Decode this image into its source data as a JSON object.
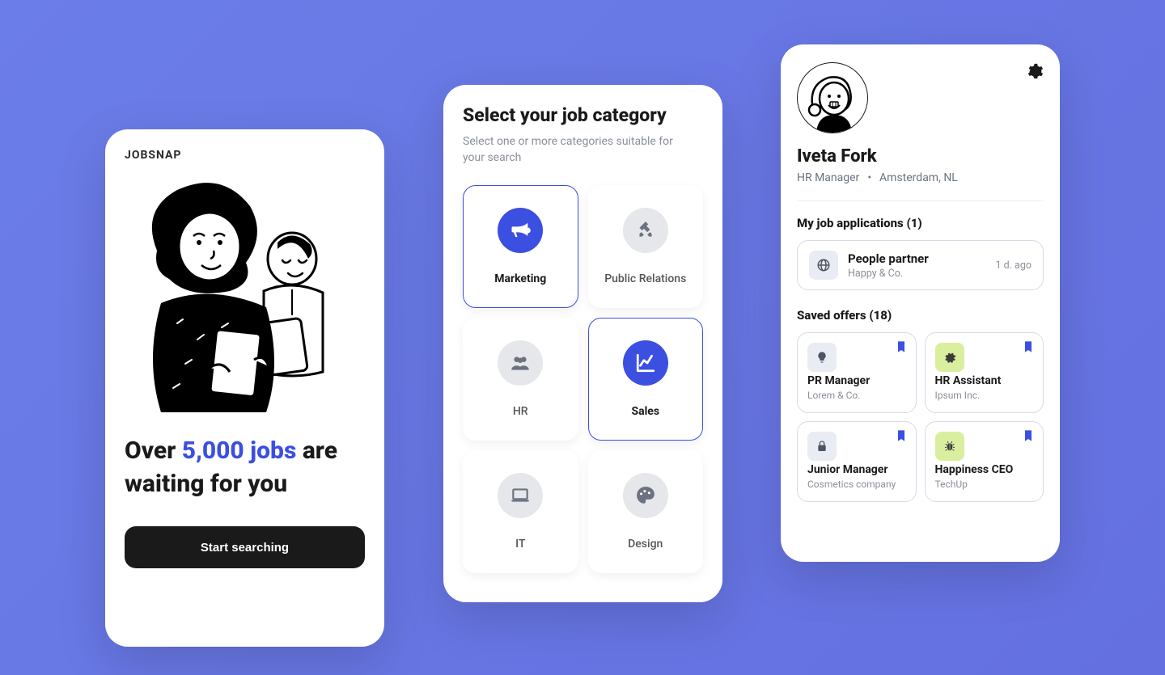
{
  "landing": {
    "brand": "JOBSNAP",
    "headline_pre": "Over ",
    "headline_accent": "5,000 jobs",
    "headline_post": " are waiting for you",
    "cta": "Start searching"
  },
  "categories": {
    "title": "Select your job category",
    "subtitle": "Select one or more categories suitable for your search",
    "items": [
      {
        "label": "Marketing",
        "selected": true
      },
      {
        "label": "Public Relations",
        "selected": false
      },
      {
        "label": "HR",
        "selected": false
      },
      {
        "label": "Sales",
        "selected": true
      },
      {
        "label": "IT",
        "selected": false
      },
      {
        "label": "Design",
        "selected": false
      }
    ]
  },
  "profile": {
    "name": "Iveta Fork",
    "role": "HR Manager",
    "location": "Amsterdam, NL",
    "applications_header": "My job applications (1)",
    "applications": [
      {
        "title": "People partner",
        "company": "Happy & Co.",
        "time": "1 d. ago"
      }
    ],
    "saved_header": "Saved offers (18)",
    "saved": [
      {
        "title": "PR Manager",
        "company": "Lorem & Co."
      },
      {
        "title": "HR Assistant",
        "company": "Ipsum Inc."
      },
      {
        "title": "Junior Manager",
        "company": "Cosmetics company"
      },
      {
        "title": "Happiness CEO",
        "company": "TechUp"
      }
    ]
  }
}
